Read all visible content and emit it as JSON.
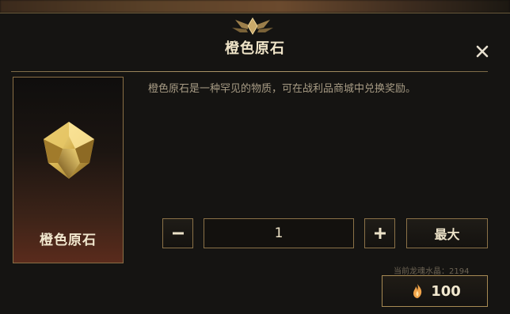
{
  "dialog": {
    "title": "橙色原石",
    "close_icon": "close-icon"
  },
  "item": {
    "name": "橙色原石",
    "icon": "orange-essence-gem-icon",
    "description": "橙色原石是一种罕见的物质，可在战利品商城中兑换奖励。"
  },
  "quantity": {
    "minus_icon": "minus-icon",
    "plus_icon": "plus-icon",
    "value": "1",
    "max_label": "最大"
  },
  "purchase": {
    "balance_text": "当前龙魂水晶：2194",
    "price": "100",
    "currency_icon": "orange-essence-icon"
  },
  "colors": {
    "accent_gold": "#8b7248",
    "background": "#151412",
    "text_light": "#efe4c8"
  }
}
